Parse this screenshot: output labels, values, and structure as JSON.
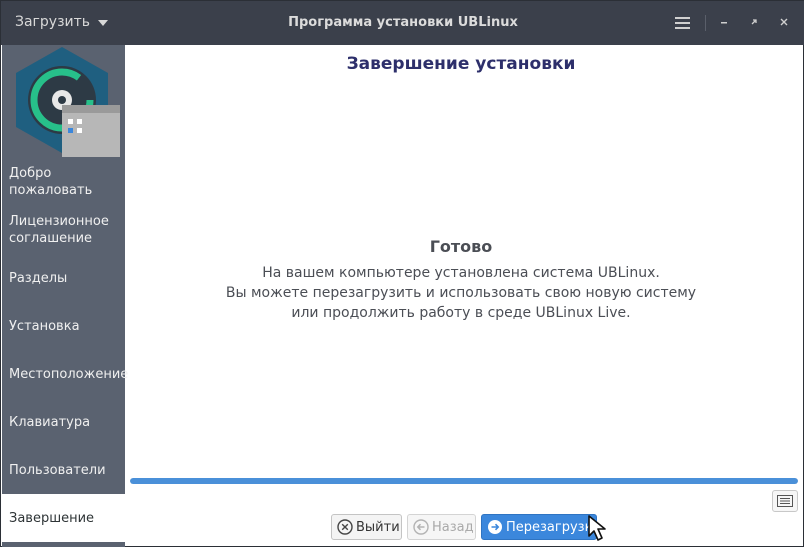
{
  "titlebar": {
    "menu_label": "Загрузить",
    "title": "Программа установки UBLinux"
  },
  "sidebar": {
    "items": [
      {
        "label": "Добро пожаловать"
      },
      {
        "label": "Лицензионное соглашение"
      },
      {
        "label": "Разделы"
      },
      {
        "label": "Установка"
      },
      {
        "label": "Местоположение"
      },
      {
        "label": "Клавиатура"
      },
      {
        "label": "Пользователи"
      },
      {
        "label": "Завершение"
      }
    ],
    "active_index": 7
  },
  "main": {
    "page_title": "Завершение установки",
    "status_title": "Готово",
    "status_lines": [
      "На вашем компьютере установлена система UBLinux.",
      "Вы можете перезагрузить и использовать свою новую систему",
      "или продолжить работу в среде UBLinux Live."
    ],
    "progress_percent": 100
  },
  "footer": {
    "exit_label": "Выйти",
    "back_label": "Назад",
    "reboot_label": "Перезагрузка"
  },
  "colors": {
    "titlebar": "#3b404b",
    "sidebar": "#5a6270",
    "accent": "#3b87dc",
    "heading": "#2d2f6b"
  },
  "icons": [
    "menu-icon",
    "minimize-icon",
    "maximize-icon",
    "close-icon",
    "log-icon",
    "exit-icon",
    "back-icon",
    "reboot-icon",
    "ublinux-logo",
    "mouse-cursor"
  ]
}
